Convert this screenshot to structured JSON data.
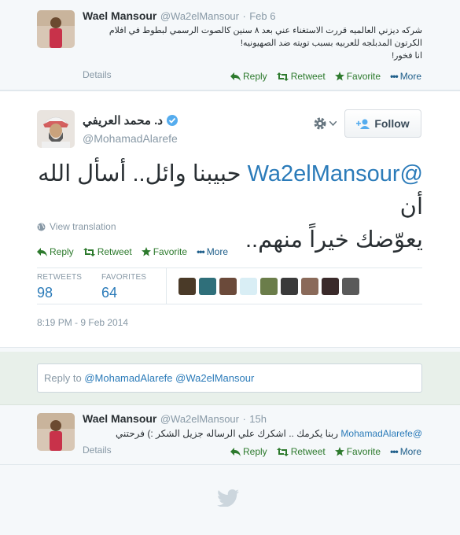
{
  "tweet1": {
    "name": "Wael Mansour",
    "handle": "@Wa2elMansour",
    "time": "Feb 6",
    "line1": "شركه ديزني العالميه قررت الاستغناء عني بعد ٨ سنين كالصوت الرسمي لبطوط في افلام",
    "line2": "الكرتون المدبلجه للعربيه بسبب تويته ضد الصهيونيه!",
    "line3": "انا فخور!",
    "details": "Details",
    "reply": "Reply",
    "retweet": "Retweet",
    "favorite": "Favorite",
    "more": "More"
  },
  "main": {
    "name": "د. محمد العريفي",
    "handle": "@MohamadAlarefe",
    "follow": "Follow",
    "mention": "@Wa2elMansour",
    "text_after_mention": "حبيبنا وائل.. أسأل الله أن",
    "text_line2": "يعوّضك خيراً منهم..",
    "view_translation": "View translation",
    "reply": "Reply",
    "retweet": "Retweet",
    "favorite": "Favorite",
    "more": "More",
    "retweets_label": "RETWEETS",
    "retweets_value": "98",
    "favorites_label": "FAVORITES",
    "favorites_value": "64",
    "timestamp": "8:19 PM - 9 Feb 2014",
    "thumb_colors": [
      "#4a3a28",
      "#2f6f7a",
      "#6b4a3a",
      "#d9eef5",
      "#6b7d4a",
      "#3a3a3a",
      "#8a6a5a",
      "#3a2a2a",
      "#5a5a5a"
    ]
  },
  "reply_box": {
    "prefix": "Reply to",
    "mention1": "@MohamadAlarefe",
    "mention2": "@Wa2elMansour"
  },
  "tweet2": {
    "name": "Wael Mansour",
    "handle": "@Wa2elMansour",
    "time": "15h",
    "mention": "@MohamadAlarefe",
    "text": "ربنا يكرمك .. اشكرك علي الرساله جزيل الشكر :) فرحتني",
    "details": "Details",
    "reply": "Reply",
    "retweet": "Retweet",
    "favorite": "Favorite",
    "more": "More"
  },
  "colors": {
    "link": "#2b7bb9",
    "action": "#2d7a2d",
    "muted": "#8899a6",
    "verified": "#55acee"
  }
}
